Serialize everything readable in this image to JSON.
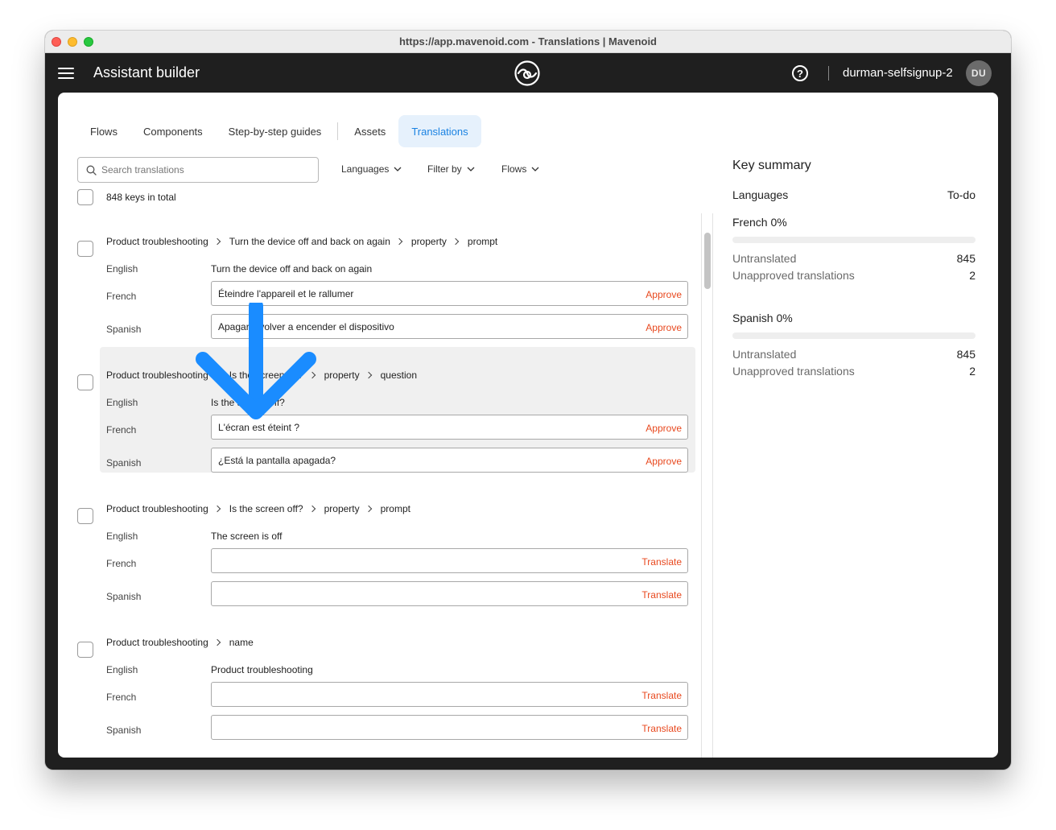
{
  "window": {
    "title": "https://app.mavenoid.com - Translations | Mavenoid"
  },
  "appbar": {
    "title": "Assistant builder",
    "username": "durman-selfsignup-2",
    "avatar_initials": "DU",
    "help_glyph": "?"
  },
  "tabs": [
    {
      "label": "Flows",
      "active": false
    },
    {
      "label": "Components",
      "active": false
    },
    {
      "label": "Step-by-step guides",
      "active": false
    },
    {
      "label": "Assets",
      "active": false
    },
    {
      "label": "Translations",
      "active": true
    }
  ],
  "filters": {
    "search_placeholder": "Search translations",
    "languages": "Languages",
    "filter_by": "Filter by",
    "flows": "Flows"
  },
  "list": {
    "total": "848 keys in total",
    "row_labels": {
      "english": "English",
      "french": "French",
      "spanish": "Spanish"
    },
    "entries": [
      {
        "crumbs": [
          "Product troubleshooting",
          "Turn the device off and back on again",
          "property",
          "prompt"
        ],
        "english": "Turn the device off and back on again",
        "french": {
          "value": "Éteindre l'appareil et le rallumer",
          "action": "Approve"
        },
        "spanish": {
          "value": "Apagar y volver a encender el dispositivo",
          "action": "Approve"
        }
      },
      {
        "crumbs": [
          "Product troubleshooting",
          "Is the screen off?",
          "property",
          "question"
        ],
        "english": "Is the screen off?",
        "french": {
          "value": "L'écran est éteint ?",
          "action": "Approve"
        },
        "spanish": {
          "value": "¿Está la pantalla apagada?",
          "action": "Approve"
        }
      },
      {
        "crumbs": [
          "Product troubleshooting",
          "Is the screen off?",
          "property",
          "prompt"
        ],
        "english": "The screen is off",
        "french": {
          "value": "",
          "action": "Translate"
        },
        "spanish": {
          "value": "",
          "action": "Translate"
        }
      },
      {
        "crumbs": [
          "Product troubleshooting",
          "name"
        ],
        "english": "Product troubleshooting",
        "french": {
          "value": "",
          "action": "Translate"
        },
        "spanish": {
          "value": "",
          "action": "Translate"
        }
      }
    ]
  },
  "summary": {
    "title": "Key summary",
    "col_languages": "Languages",
    "col_todo": "To-do",
    "languages": [
      {
        "title": "French 0%",
        "progress": 0,
        "untranslated_label": "Untranslated",
        "untranslated": "845",
        "unapproved_label": "Unapproved translations",
        "unapproved": "2"
      },
      {
        "title": "Spanish 0%",
        "progress": 0,
        "untranslated_label": "Untranslated",
        "untranslated": "845",
        "unapproved_label": "Unapproved translations",
        "unapproved": "2"
      }
    ]
  },
  "colors": {
    "accent": "#1a82e2",
    "action": "#e8481e",
    "annotation_arrow": "#1a8cff",
    "appbar": "#1f1f1f"
  }
}
